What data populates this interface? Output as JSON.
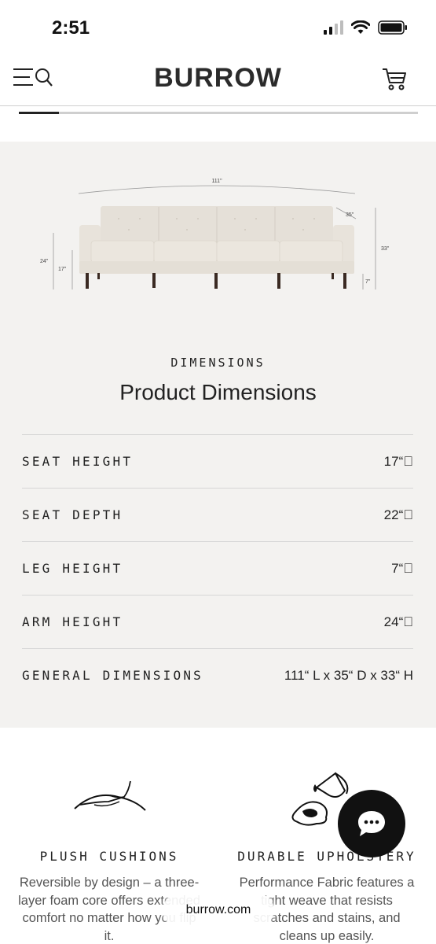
{
  "status_bar": {
    "time": "2:51",
    "icons": [
      "cellular-signal-icon",
      "wifi-icon",
      "battery-icon"
    ]
  },
  "header": {
    "logo": "BURROW",
    "menu_icon": "menu-search-icon",
    "cart_icon": "cart-icon"
  },
  "progress": {
    "fraction": 0.1
  },
  "dimensions": {
    "figure_labels": {
      "width": "111\"",
      "depth": "35\"",
      "height": "33\"",
      "arm_height": "24\"",
      "seat_height": "17\"",
      "leg_height": "7\""
    },
    "eyebrow": "DIMENSIONS",
    "title": "Product Dimensions",
    "rows": [
      {
        "label": "SEAT HEIGHT",
        "value": "17“\u0000"
      },
      {
        "label": "SEAT DEPTH",
        "value": "22“\u0000"
      },
      {
        "label": "LEG HEIGHT",
        "value": "7“\u0000"
      },
      {
        "label": "ARM HEIGHT",
        "value": "24“\u0000"
      },
      {
        "label": "GENERAL DIMENSIONS",
        "value": "111“ L x 35“ D x 33“ H"
      }
    ]
  },
  "features": [
    {
      "icon": "hand-on-cushion-icon",
      "title": "PLUSH CUSHIONS",
      "description": "Reversible by design – a three-layer foam core offers extended comfort no matter how you flip it."
    },
    {
      "icon": "wine-spill-icon",
      "title": "DURABLE UPHOLSTERY",
      "description": "Performance Fabric features a tight weave that resists scratches and stains, and cleans up easily."
    }
  ],
  "chat": {
    "icon": "chat-bubble-icon"
  },
  "url_bar": {
    "domain": "burrow.com"
  },
  "colors": {
    "panel_bg": "#f3f2f0",
    "text": "#222222",
    "chat_button": "#111111"
  }
}
